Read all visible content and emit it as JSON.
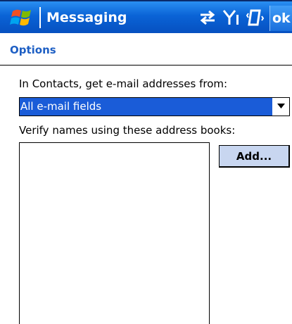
{
  "titlebar": {
    "app_title": "Messaging",
    "ok_label": "ok",
    "status_icons": [
      "connectivity-icon",
      "signal-icon",
      "vibrate-icon"
    ],
    "colors": {
      "bar_top": "#2a8ff2",
      "bar_bottom": "#0650c0"
    }
  },
  "page": {
    "title": "Options",
    "title_color": "#1e5fc4"
  },
  "contacts": {
    "label": "In Contacts, get e-mail addresses from:",
    "selected_value": "All e-mail fields",
    "selection_color": "#1a5cd8"
  },
  "address_books": {
    "label": "Verify names using these address books:",
    "items": [],
    "add_label": "Add..."
  }
}
